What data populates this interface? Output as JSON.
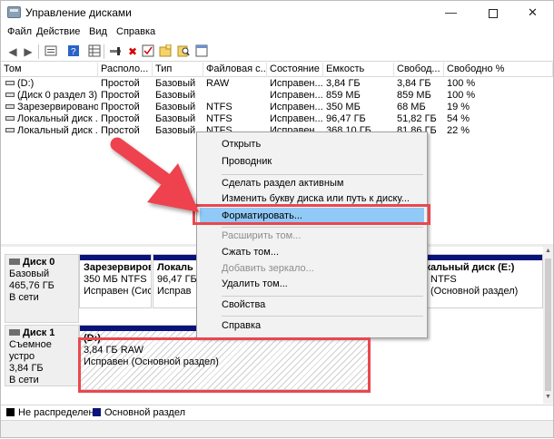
{
  "window": {
    "title": "Управление дисками",
    "minimize": "—",
    "close": "✕"
  },
  "menu": {
    "items": [
      "Файл",
      "Действие",
      "Вид",
      "Справка"
    ]
  },
  "toolbar": {
    "icons": [
      "back-arrow-icon",
      "forward-arrow-icon",
      "properties-icon",
      "help-icon",
      "grid-icon",
      "connect-icon",
      "delete-icon",
      "checkmark-icon",
      "new-folder-icon",
      "search-icon",
      "window-icon"
    ]
  },
  "volumes": {
    "columns": [
      "Том",
      "Располо...",
      "Тип",
      "Файловая с...",
      "Состояние",
      "Емкость",
      "Свобод...",
      "Свободно %"
    ],
    "rows": [
      [
        "(D:)",
        "Простой",
        "Базовый",
        "RAW",
        "Исправен...",
        "3,84 ГБ",
        "3,84 ГБ",
        "100 %"
      ],
      [
        "(Диск 0 раздел 3)",
        "Простой",
        "Базовый",
        "",
        "Исправен...",
        "859 МБ",
        "859 МБ",
        "100 %"
      ],
      [
        "Зарезервировано...",
        "Простой",
        "Базовый",
        "NTFS",
        "Исправен...",
        "350 МБ",
        "68 МБ",
        "19 %"
      ],
      [
        "Локальный диск ...",
        "Простой",
        "Базовый",
        "NTFS",
        "Исправен...",
        "96,47 ГБ",
        "51,82 ГБ",
        "54 %"
      ],
      [
        "Локальный диск ...",
        "Простой",
        "Базовый",
        "NTFS",
        "Исправен...",
        "368,10 ГБ",
        "81,86 ГБ",
        "22 %"
      ]
    ]
  },
  "disks": [
    {
      "label": "Диск 0",
      "type": "Базовый",
      "size": "465,76 ГБ",
      "status": "В сети",
      "partitions": [
        {
          "name": "Зарезервиров",
          "size": "350 МБ NTFS",
          "status": "Исправен (Сис"
        },
        {
          "name": "Локаль",
          "size": "96,47 ГБ",
          "status": "Исправ"
        },
        {
          "name": "Локальный диск  (E:)",
          "size": "NTFS",
          "status": "(Основной раздел)"
        }
      ]
    },
    {
      "label": "Диск 1",
      "type": "Съемное устро",
      "size": "3,84 ГБ",
      "status": "В сети",
      "partitions": [
        {
          "name": "(D:)",
          "size": "3,84 ГБ RAW",
          "status": "Исправен (Основной раздел)"
        }
      ]
    }
  ],
  "context_menu": {
    "items": [
      {
        "label": "Открыть",
        "disabled": false
      },
      {
        "label": "Проводник",
        "disabled": false
      },
      {
        "label": "Сделать раздел активным",
        "disabled": false
      },
      {
        "label": "Изменить букву диска или путь к диску...",
        "disabled": false
      },
      {
        "label": "Форматировать...",
        "disabled": false,
        "selected": true
      },
      {
        "label": "Расширить том...",
        "disabled": true
      },
      {
        "label": "Сжать том...",
        "disabled": false
      },
      {
        "label": "Добавить зеркало...",
        "disabled": true
      },
      {
        "label": "Удалить том...",
        "disabled": false
      },
      {
        "label": "Свойства",
        "disabled": false
      },
      {
        "label": "Справка",
        "disabled": false
      }
    ]
  },
  "legend": [
    {
      "label": "Не распределена",
      "color": "#000000"
    },
    {
      "label": "Основной раздел",
      "color": "#08147a"
    }
  ],
  "colors": {
    "highlight": "#e8484f",
    "primary_partition": "#08147a",
    "menu_selection": "#91c9f7"
  }
}
